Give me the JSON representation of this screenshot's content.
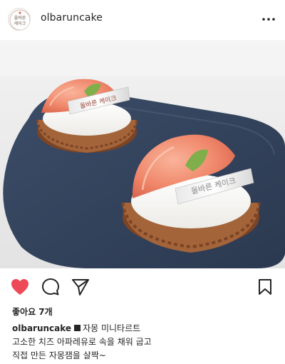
{
  "post": {
    "username": "olbaruncake",
    "avatar_text_line1": "올바른",
    "avatar_text_line2": "케이크",
    "photo": {
      "tag_text": "올바른 케이크",
      "colors": {
        "background": "#ececec",
        "plate": "#35465f",
        "cream": "#fbfbf9",
        "tart_crust": "#9a5c36",
        "grapefruit": "#f28a6c",
        "leaf": "#7fae4b"
      }
    },
    "actions": {
      "like_icon": "heart-icon",
      "like_color": "#ed4956",
      "comment_icon": "comment-icon",
      "share_icon": "paper-plane-icon",
      "save_icon": "bookmark-icon"
    },
    "likes_text": "좋아요 7개",
    "caption": {
      "user": "olbaruncake",
      "title": "자몽 미니타르트",
      "line2": "고소한 치즈 아파레유로 속을 채워 굽고",
      "line3": "직접 만든 자몽잼을 살짝~"
    }
  }
}
